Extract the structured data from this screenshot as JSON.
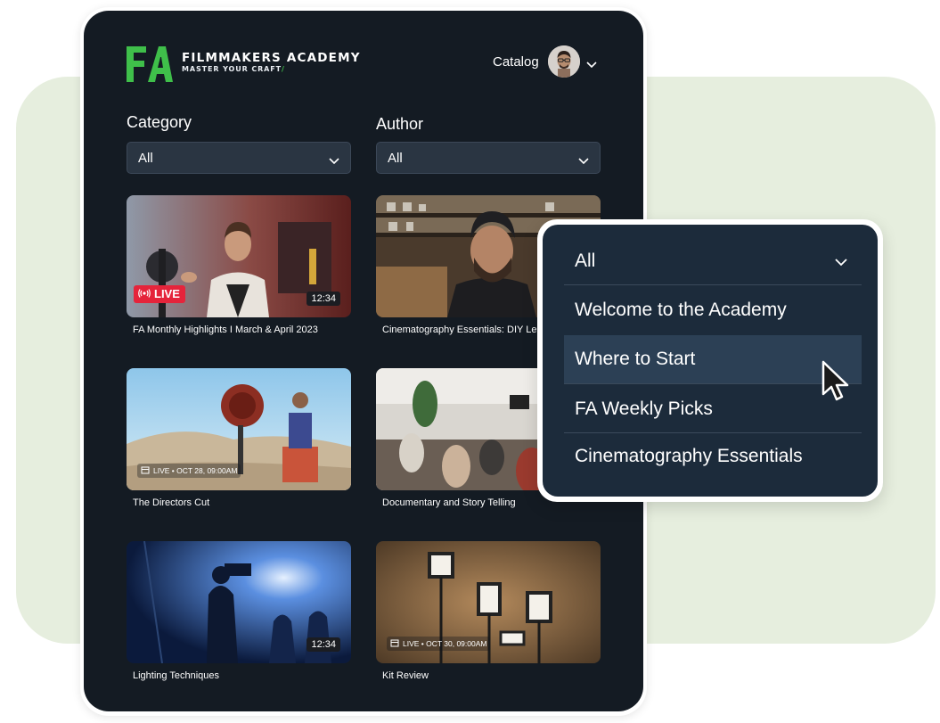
{
  "brand": {
    "logo_text": "FA",
    "name": "FILMMAKERS ACADEMY",
    "tagline": "MASTER YOUR CRAFT",
    "accent_color": "#3fbf4a"
  },
  "header": {
    "nav_label": "Catalog",
    "profile_icon": "chevron-down-icon"
  },
  "filters": {
    "category": {
      "label": "Category",
      "value": "All"
    },
    "author": {
      "label": "Author",
      "value": "All"
    }
  },
  "cards": [
    {
      "title": "FA Monthly Highlights I March & April 2023",
      "badge": "LIVE",
      "duration": "12:34",
      "live_color": "#e5243b"
    },
    {
      "title": "Cinematography Essentials: DIY Lenses"
    },
    {
      "title": "The Directors Cut",
      "schedule": "LIVE • OCT 28, 09:00AM"
    },
    {
      "title": "Documentary and Story Telling"
    },
    {
      "title": "Lighting Techniques",
      "duration": "12:34"
    },
    {
      "title": "Kit Review",
      "schedule": "LIVE • OCT 30, 09:00AM"
    }
  ],
  "dropdown": {
    "selected": "All",
    "options": [
      {
        "label": "Welcome to the Academy"
      },
      {
        "label": "Where to Start",
        "highlighted": true
      },
      {
        "label": "FA Weekly Picks"
      },
      {
        "label": "Cinematography Essentials"
      }
    ]
  }
}
